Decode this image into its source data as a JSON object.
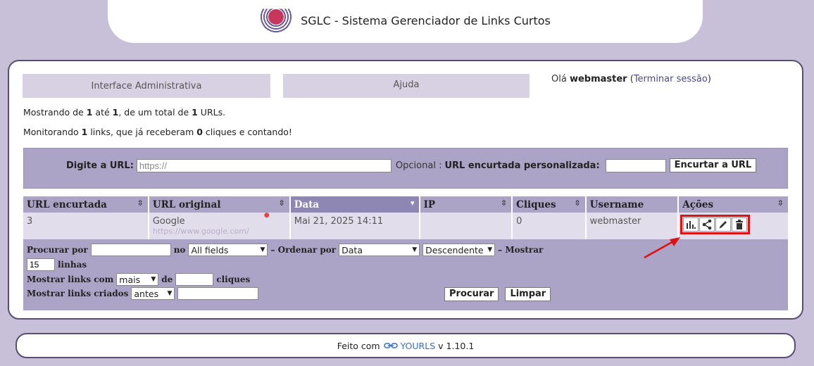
{
  "header": {
    "title": "SGLC - Sistema Gerenciador de Links Curtos"
  },
  "nav": {
    "admin_tab": "Interface Administrativa",
    "help_tab": "Ajuda"
  },
  "user": {
    "greeting": "Olá",
    "username": "webmaster",
    "logout": "Terminar sessão"
  },
  "summary": {
    "showing_pre": "Mostrando de ",
    "from": "1",
    "to_word": " até ",
    "to": "1",
    "total_pre": ", de um total de ",
    "total": "1",
    "total_post": " URLs.",
    "tracking_pre": "Monitorando ",
    "links": "1",
    "tracking_mid": " links, que já receberam ",
    "clicks": "0",
    "tracking_post": " cliques e contando!"
  },
  "new_url": {
    "url_label": "Digite a URL",
    "url_placeholder": "https://",
    "optional_label": "Opcional",
    "keyword_label": "URL encurtada personalizada",
    "submit": "Encurtar a URL"
  },
  "table": {
    "headers": [
      "URL encurtada",
      "URL original",
      "Data",
      "IP",
      "Cliques",
      "Username",
      "Ações"
    ],
    "sorted_column": "Data",
    "rows": [
      {
        "short": "3",
        "title": "Google",
        "url": "https://www.google.com/",
        "date": "Mai 21, 2025 14:11",
        "ip": "",
        "clicks": "0",
        "username": "webmaster"
      }
    ],
    "actions": [
      "stats-icon",
      "share-icon",
      "edit-icon",
      "delete-icon"
    ]
  },
  "filters": {
    "search_label": "Procurar por",
    "in_label": "no",
    "in_value": "All fields",
    "order_label": "– Ordenar por",
    "order_value": "Data",
    "direction_value": "Descendente",
    "show_label": "– Mostrar",
    "per_page_value": "15",
    "lines_label": "linhas",
    "links_with_label": "Mostrar links com",
    "links_with_value": "mais",
    "of_label": "de",
    "clicks_label": "cliques",
    "created_label": "Mostrar links criados",
    "created_value": "antes",
    "search_button": "Procurar",
    "clear_button": "Limpar"
  },
  "footer": {
    "made_with": "Feito com",
    "brand": "YOURLS",
    "version": "v 1.10.1"
  },
  "colors": {
    "background": "#c8c0d8",
    "panel": "#aba4c6",
    "border": "#5a4d72",
    "highlight": "#e01010"
  }
}
